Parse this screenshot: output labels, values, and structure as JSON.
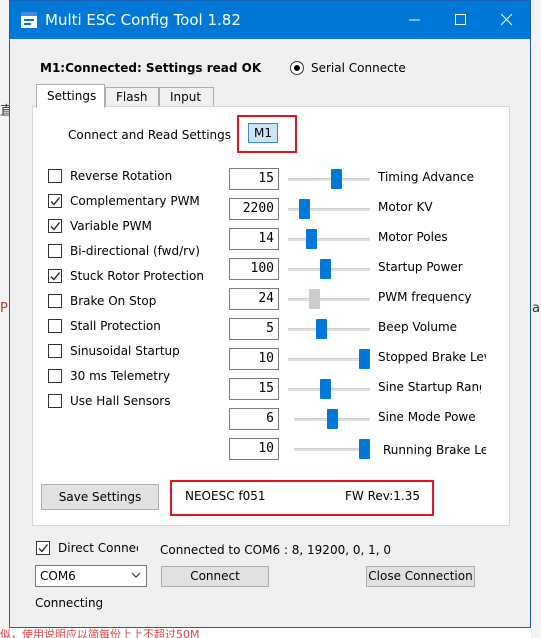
{
  "window": {
    "title": "Multi ESC Config Tool 1.82"
  },
  "background": {
    "left_glyph_1": "直",
    "left_glyph_2": "P",
    "right_glyph": "a",
    "bottom_text": "似，使用说明应以简每份上上不超过50M"
  },
  "status": {
    "main": "M1:Connected: Settings read OK",
    "radio_label": "Serial Connected"
  },
  "tabs": [
    {
      "label": "Settings",
      "active": true
    },
    {
      "label": "Flash",
      "active": false
    },
    {
      "label": "Input",
      "active": false
    }
  ],
  "settings": {
    "connect_read_label": "Connect and Read Settings",
    "esc_field": "M1",
    "checkboxes": [
      {
        "label": "Reverse Rotation",
        "checked": false
      },
      {
        "label": "Complementary PWM",
        "checked": true
      },
      {
        "label": "Variable PWM",
        "checked": true
      },
      {
        "label": "Bi-directional (fwd/rv)",
        "checked": false
      },
      {
        "label": "Stuck Rotor Protection",
        "checked": true
      },
      {
        "label": "Brake On Stop",
        "checked": false
      },
      {
        "label": "Stall Protection",
        "checked": false
      },
      {
        "label": "Sinusoidal Startup",
        "checked": false
      },
      {
        "label": "30 ms Telemetry",
        "checked": false
      },
      {
        "label": "Use Hall Sensors",
        "checked": false
      }
    ],
    "sliders": [
      {
        "label": "Timing Advance",
        "value": "15",
        "position": 0.6,
        "enabled": true
      },
      {
        "label": "Motor KV",
        "value": "2200",
        "position": 0.15,
        "enabled": true
      },
      {
        "label": "Motor Poles",
        "value": "14",
        "position": 0.25,
        "enabled": true
      },
      {
        "label": "Startup Power",
        "value": "100",
        "position": 0.45,
        "enabled": true
      },
      {
        "label": "PWM frequency",
        "value": "24",
        "position": 0.3,
        "enabled": false
      },
      {
        "label": "Beep Volume",
        "value": "5",
        "position": 0.4,
        "enabled": true
      },
      {
        "label": "Stopped Brake Level",
        "value": "10",
        "position": 1.0,
        "enabled": true
      },
      {
        "label": "Sine Startup Range",
        "value": "15",
        "position": 0.45,
        "enabled": true
      },
      {
        "label": "Sine Mode Power",
        "value": "6",
        "position": 0.5,
        "enabled": true
      },
      {
        "label": "Running Brake Level",
        "value": "10",
        "position": 1.0,
        "enabled": true
      }
    ],
    "save_label": "Save Settings",
    "esc_name": "NEOESC f051",
    "fw_rev": "FW Rev:1.35"
  },
  "connection": {
    "direct_label": "Direct Connect",
    "direct_checked": true,
    "connected_text": "Connected to COM6 : 8, 19200, 0, 1, 0",
    "port": "COM6",
    "connect_label": "Connect",
    "close_label": "Close Connection",
    "status": "Connecting"
  },
  "colors": {
    "accent": "#0078d7",
    "highlight": "#e0151b",
    "selected_field": "#cce4f7"
  }
}
